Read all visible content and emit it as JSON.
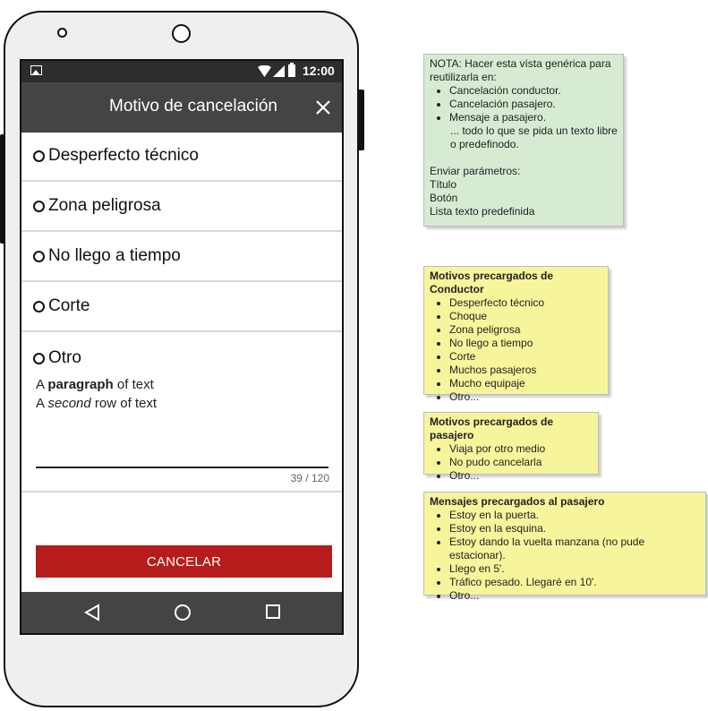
{
  "status_bar": {
    "time": "12:00"
  },
  "dialog": {
    "title": "Motivo de cancelación",
    "options": [
      {
        "label": "Desperfecto técnico"
      },
      {
        "label": "Zona peligrosa"
      },
      {
        "label": "No llego a tiempo"
      },
      {
        "label": "Corte"
      },
      {
        "label": "Otro"
      }
    ],
    "textarea": {
      "line1_prefix": "A ",
      "line1_bold": "paragraph",
      "line1_suffix": " of text",
      "line2_prefix": "A ",
      "line2_italic": "second",
      "line2_suffix": " row of text",
      "char_count": "39 / 120"
    },
    "cancel_label": "CANCELAR"
  },
  "notes": {
    "generic": {
      "intro": "NOTA: Hacer esta vísta genérica para reutilizarla en:",
      "items": [
        "Cancelación conductor.",
        "Cancelación pasajero.",
        "Mensaje a pasajero."
      ],
      "extra": "... todo lo que se pida un texto libre o predefinodo.",
      "params_title": "Enviar parámetros:",
      "params": [
        "Título",
        "Botón",
        "Lista texto predefinida"
      ]
    },
    "conductor": {
      "title": "Motivos precargados de Conductor",
      "items": [
        "Desperfecto técnico",
        "Choque",
        "Zona peligrosa",
        "No llego a tiempo",
        "Corte",
        "Muchos pasajeros",
        "Mucho equipaje",
        "Otro..."
      ]
    },
    "pasajero": {
      "title": "Motivos precargados de pasajero",
      "items": [
        "Viaja por otro medio",
        "No pudo cancelarla",
        "Otro..."
      ]
    },
    "mensajes": {
      "title": "Mensajes precargados al pasajero",
      "items": [
        "Estoy en la puerta.",
        "Estoy en la esquina.",
        "Estoy dando la vuelta manzana (no pude estacionar).",
        "Llego en 5'.",
        "Tráfico pesado. Llegaré en 10'.",
        "Otro..."
      ]
    }
  },
  "colors": {
    "app_bar": "#444444",
    "cancel_button": "#b71c1c",
    "note_green": "#d7ebd3",
    "note_yellow": "#f7f59b"
  }
}
